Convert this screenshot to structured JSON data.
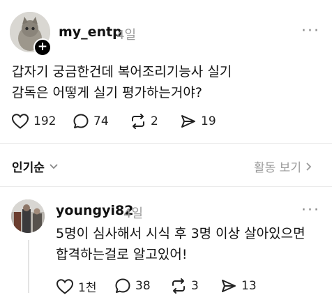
{
  "post": {
    "username": "my_entp",
    "time": "4일",
    "text": "갑자기 궁금한건데 복어조리기능사 실기\n감독은 어떻게 실기 평가하는거야?",
    "likes": "192",
    "comments": "74",
    "reposts": "2",
    "shares": "19"
  },
  "sort": {
    "label": "인기순",
    "activity_link": "활동 보기"
  },
  "reply": {
    "username": "youngyi82",
    "time": "4일",
    "text": "5명이 심사해서 시식 후 3명 이상 살아있으면\n합격하는걸로 알고있어!",
    "likes": "1천",
    "comments": "38",
    "reposts": "3",
    "shares": "13"
  },
  "icons": {
    "more": "more-horizontal-icon",
    "like": "heart-icon",
    "comment": "comment-bubble-icon",
    "repost": "repost-arrows-icon",
    "share": "send-icon",
    "chevron": "chevron-down-icon"
  }
}
